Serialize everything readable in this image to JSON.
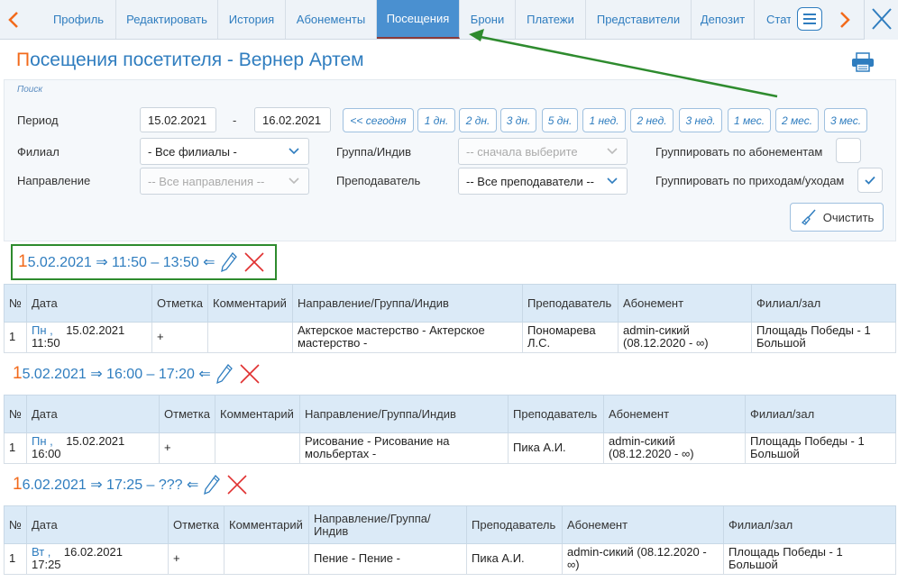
{
  "tabs": [
    "Профиль",
    "Редактировать",
    "История",
    "Абонементы",
    "Посещения",
    "Брони",
    "Платежи",
    "Представители",
    "Депозит",
    "Стат"
  ],
  "title": {
    "first": "П",
    "rest": "осещения посетителя - Вернер Артем"
  },
  "search": {
    "label": "Поиск",
    "period_label": "Период",
    "date_from": "15.02.2021",
    "dash": "-",
    "date_to": "16.02.2021",
    "quick": [
      "<< сегодня",
      "1 дн.",
      "2 дн.",
      "3 дн.",
      "5 дн.",
      "1 нед.",
      "2 нед.",
      "3 нед.",
      "1 мес.",
      "2 мес.",
      "3 мес."
    ],
    "branch_label": "Филиал",
    "branch_value": "- Все филиалы -",
    "group_label": "Группа/Индив",
    "group_value": "-- сначала выберите",
    "group_by_sub_label": "Группировать по абонементам",
    "direction_label": "Направление",
    "direction_value": "-- Все направления --",
    "teacher_label": "Преподаватель",
    "teacher_value": "-- Все преподаватели --",
    "group_by_in_label": "Группировать по приходам/уходам",
    "clear_label": "Очистить"
  },
  "columns": [
    "№",
    "Дата",
    "Отметка",
    "Комментарий",
    "Направление/Группа/Индив",
    "Преподаватель",
    "Абонемент",
    "Филиал/зал"
  ],
  "columns_wrapped": [
    "№",
    "Дата",
    "Отметка",
    "Комментарий",
    "Направление/Группа/\nИндив",
    "Преподаватель",
    "Абонемент",
    "Филиал/зал"
  ],
  "visits": [
    {
      "first": "1",
      "rest": "5.02.2021 ⇒ 11:50 – 13:50 ⇐",
      "row": {
        "num": "1",
        "dow": "Пн ,",
        "date": "15.02.2021",
        "time": "11:50",
        "mark": "+",
        "comment": "",
        "direction": "Актерское мастерство - Актерское мастерство   -",
        "teacher": "Пономарева Л.С.",
        "subscription": "admin-сикий (08.12.2020 - ∞)",
        "branch": "Площадь Победы - 1 Большой"
      }
    },
    {
      "first": "1",
      "rest": "5.02.2021 ⇒ 16:00 – 17:20 ⇐",
      "row": {
        "num": "1",
        "dow": "Пн ,",
        "date": "15.02.2021",
        "time": "16:00",
        "mark": "+",
        "comment": "",
        "direction": "Рисование - Рисование на мольбертах   -",
        "teacher": "Пика А.И.",
        "subscription": "admin-сикий (08.12.2020 - ∞)",
        "branch": "Площадь Победы - 1 Большой"
      }
    },
    {
      "first": "1",
      "rest": "6.02.2021 ⇒ 17:25 – ??? ⇐",
      "row": {
        "num": "1",
        "dow": "Вт ,",
        "date": "16.02.2021",
        "time": "17:25",
        "mark": "+",
        "comment": "",
        "direction": "Пение - Пение   -",
        "teacher": "Пика А.И.",
        "subscription": "admin-сикий (08.12.2020 - ∞)",
        "branch": "Площадь Победы - 1 Большой"
      }
    }
  ]
}
